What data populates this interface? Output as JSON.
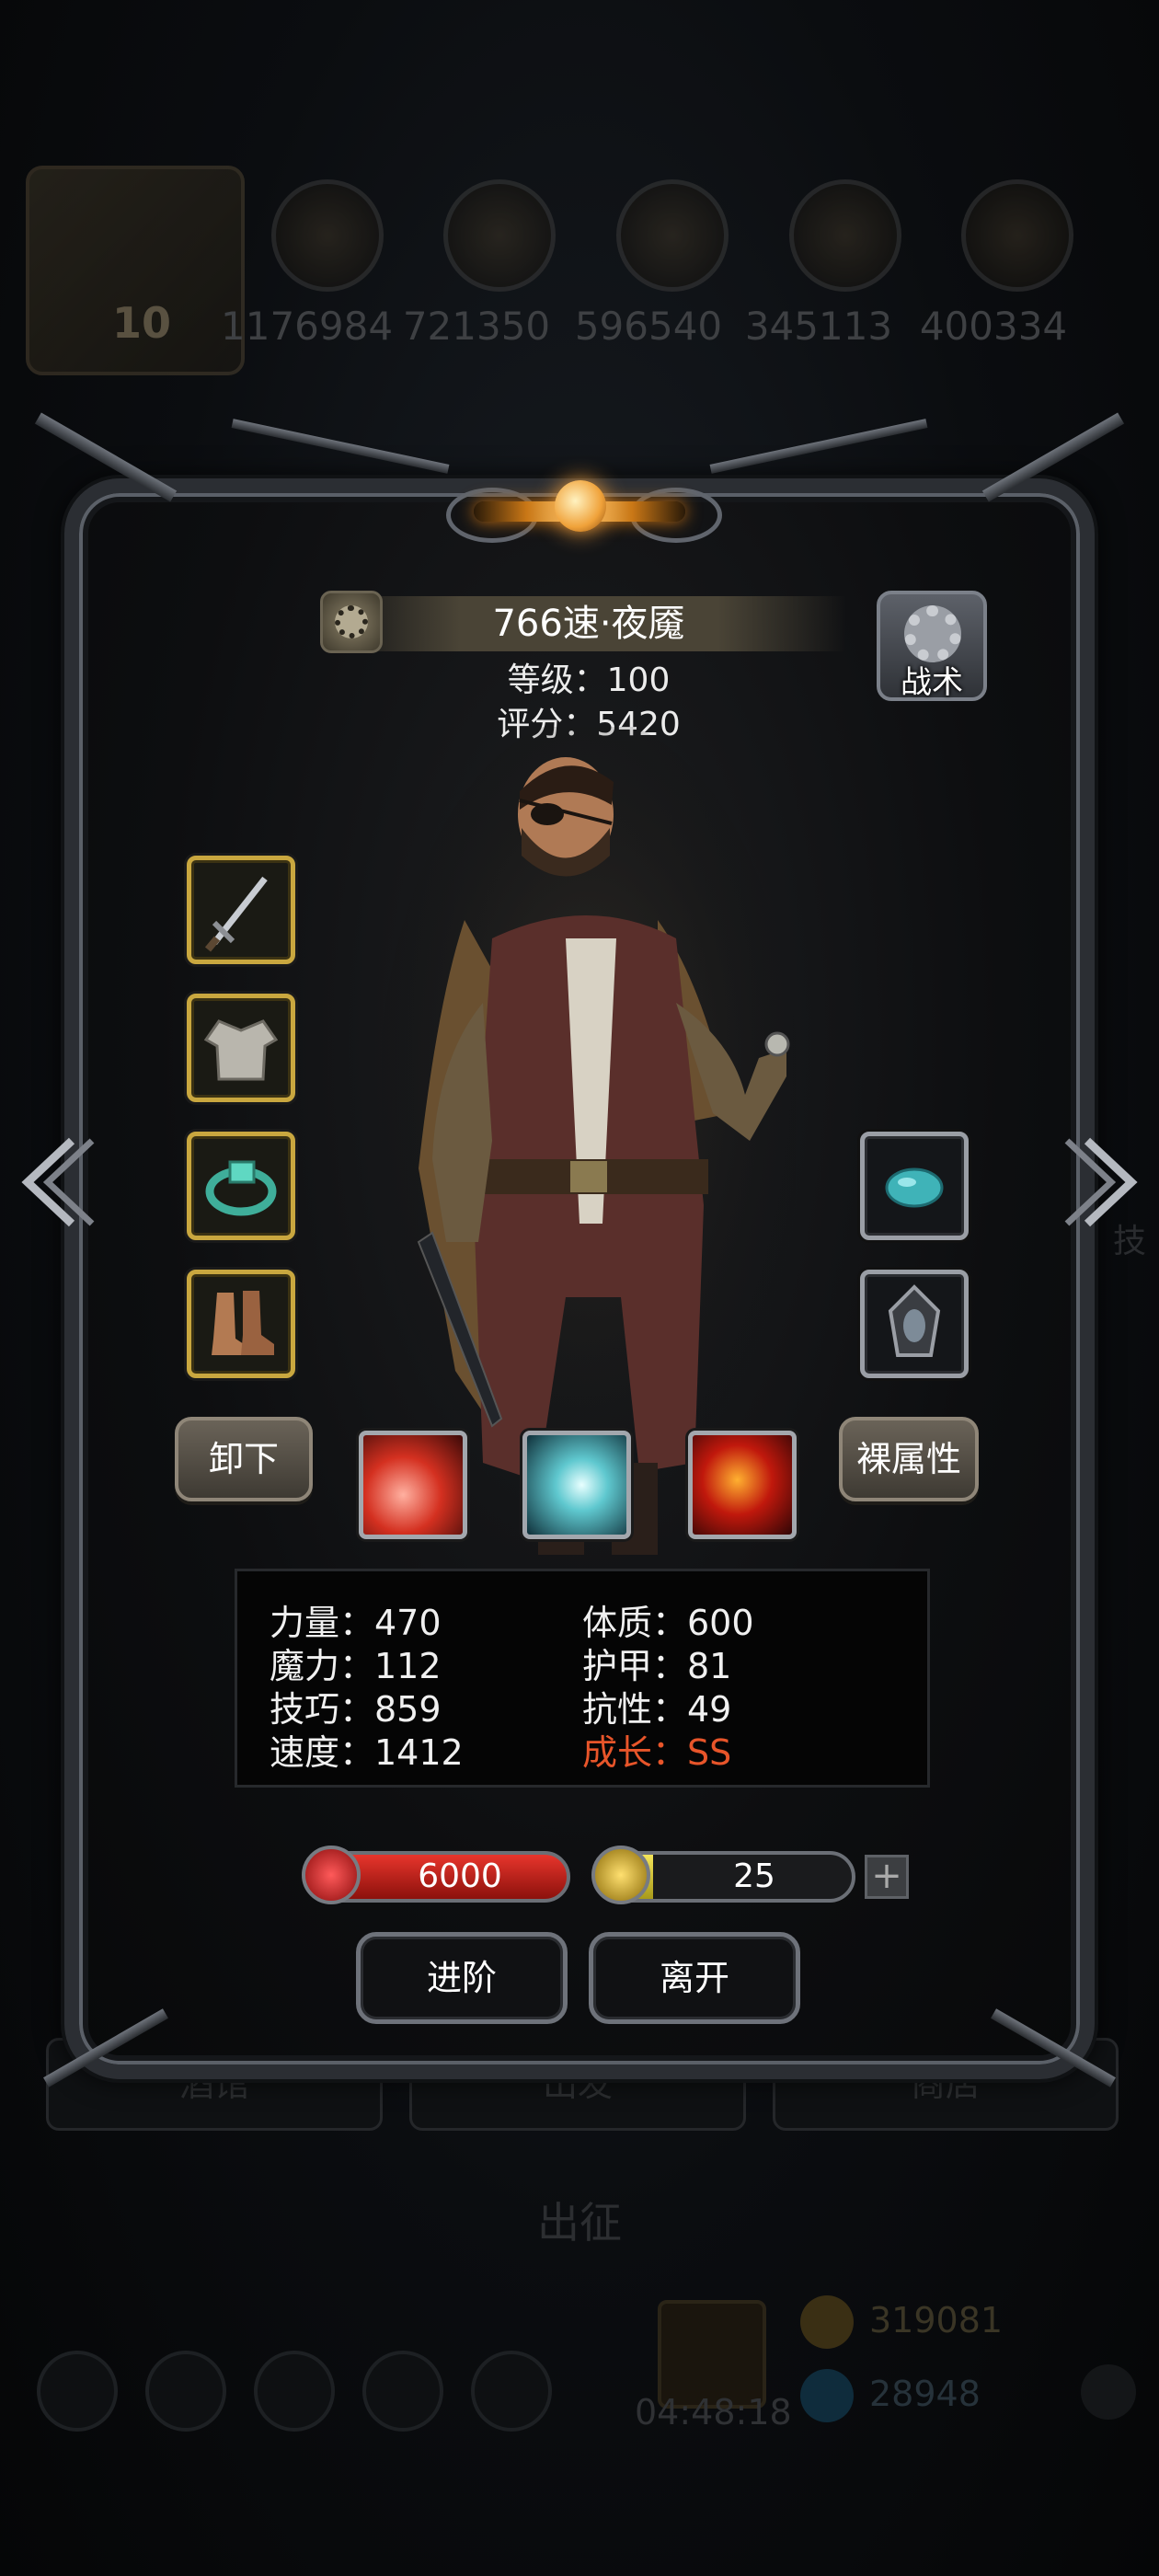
{
  "background": {
    "resources": [
      "1176984",
      "721350",
      "596540",
      "345113",
      "400334"
    ],
    "avatar_level": "10",
    "tabs": [
      "酒馆",
      "出发",
      "商店"
    ],
    "center_label": "出征",
    "gift_timer": "04:48:18",
    "gold": "319081",
    "gems": "28948",
    "edge_text": "技"
  },
  "hero": {
    "name": "766速·夜魇",
    "level": "等级：100",
    "score": "评分：5420"
  },
  "tactic_label": "战术",
  "buttons": {
    "unequip": "卸下",
    "base_attributes": "裸属性",
    "advance": "进阶",
    "leave": "离开"
  },
  "stats": [
    {
      "label": "力量：470"
    },
    {
      "label": "体质：600"
    },
    {
      "label": "魔力：112"
    },
    {
      "label": "护甲：81"
    },
    {
      "label": "技巧：859"
    },
    {
      "label": "抗性：49"
    },
    {
      "label": "速度：1412"
    },
    {
      "label": "成长：SS"
    }
  ],
  "hp": "6000",
  "energy": "25",
  "energy_fill_fraction": 0.22,
  "plus_label": "+",
  "colors": {
    "accent_gold": "#c9a73f",
    "growth_highlight": "#e8552a",
    "hp_red": "#e7352c",
    "energy_yellow": "#f4e55a"
  },
  "equipment": {
    "left": [
      "sword-icon",
      "armor-icon",
      "ring-icon",
      "boots-icon"
    ],
    "right": [
      "gem-icon",
      "amulet-icon"
    ]
  },
  "skills": [
    "slash-skill-icon",
    "whirl-skill-icon",
    "flame-skill-icon"
  ]
}
